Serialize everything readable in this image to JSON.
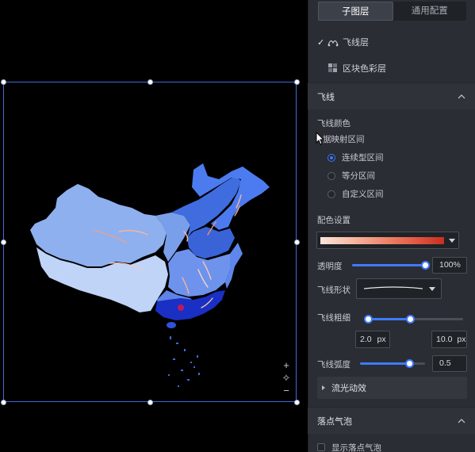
{
  "tabs": [
    {
      "label": "子图层",
      "active": true
    },
    {
      "label": "通用配置",
      "active": false
    }
  ],
  "layers": [
    {
      "label": "飞线层",
      "checked": true,
      "icon": "flight-line-icon"
    },
    {
      "label": "区块色彩层",
      "checked": false,
      "icon": "region-color-icon"
    }
  ],
  "sections": {
    "flight": "飞线",
    "bubble": "落点气泡"
  },
  "flight": {
    "color_label": "飞线颜色",
    "mapping_label": "据映射区间",
    "mapping_options": [
      {
        "label": "连续型区间",
        "selected": true
      },
      {
        "label": "等分区间",
        "selected": false
      },
      {
        "label": "自定义区间",
        "selected": false
      }
    ],
    "palette_label": "配色设置",
    "palette_colors": [
      "#fbe4dc",
      "#f6b9a4",
      "#ee8a70",
      "#e35c45",
      "#c92e22"
    ],
    "opacity_label": "透明度",
    "opacity_value": "100%",
    "opacity_fraction": 1.0,
    "shape_label": "飞线形状",
    "width_label": "飞线粗细",
    "width_min": "2.0",
    "width_max": "10.0",
    "width_unit": "px",
    "width_range_fraction": [
      0.0,
      0.44
    ],
    "arc_label": "飞线弧度",
    "arc_value": "0.5",
    "arc_fraction": 0.75,
    "flow_label": "流光动效"
  },
  "bubble": {
    "show_label": "显示落点气泡",
    "checked": false
  },
  "zoom_controls": {
    "zoom_in": "+",
    "reset": "✧",
    "zoom_out": "−"
  },
  "colors": {
    "accent": "#3d7bff",
    "panel_bg": "#2a2d33",
    "selection_border": "#3f6ad8"
  }
}
